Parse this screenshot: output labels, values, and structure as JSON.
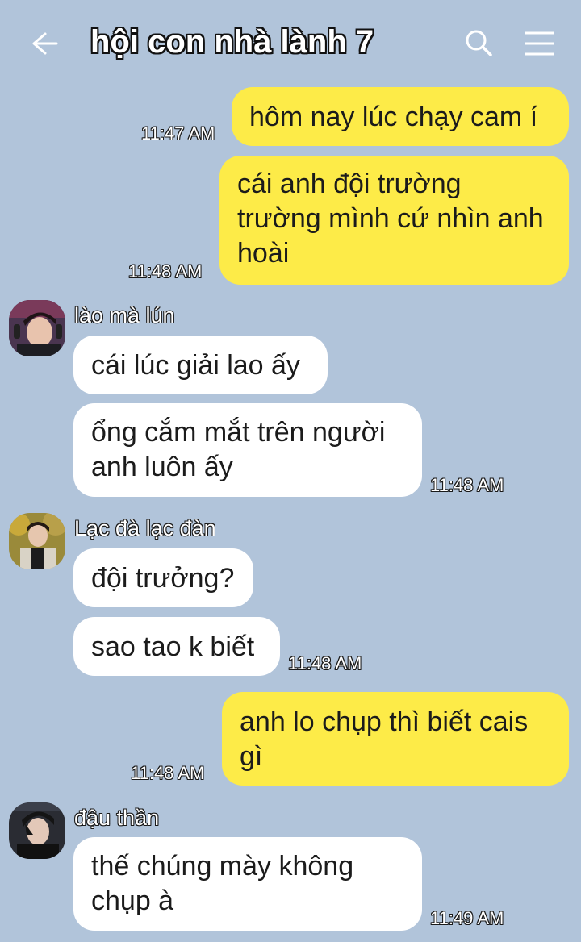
{
  "header": {
    "title": "hội con nhà lành 7",
    "back_icon": "arrow-left-icon",
    "search_icon": "search-icon",
    "menu_icon": "hamburger-menu-icon"
  },
  "colors": {
    "background": "#b1c4da",
    "outgoing_bubble": "#fdeb48",
    "incoming_bubble": "#ffffff"
  },
  "messages": [
    {
      "direction": "out",
      "text": "hôm nay lúc chạy cam í",
      "time": "11:47 AM"
    },
    {
      "direction": "out",
      "text_lines": [
        "cái anh đội trường",
        "trường mình cứ nhìn anh",
        "hoài"
      ],
      "time": "11:48 AM"
    },
    {
      "direction": "in",
      "sender": "lào mà lún",
      "text": "cái lúc giải lao ấy"
    },
    {
      "direction": "in",
      "text_lines": [
        "ổng cắm mắt trên người",
        "anh luôn ấy"
      ],
      "time": "11:48 AM"
    },
    {
      "direction": "in",
      "sender": "Lạc đà lạc đàn",
      "text": "đội trưởng?"
    },
    {
      "direction": "in",
      "text": "sao tao k biết",
      "time": "11:48 AM"
    },
    {
      "direction": "out",
      "text_lines": [
        "anh lo chụp thì biết cais",
        "gì"
      ],
      "time": "11:48 AM"
    },
    {
      "direction": "in",
      "sender": "đậu thần",
      "text_lines": [
        "thế chúng mày không",
        "chụp à"
      ],
      "time": "11:49 AM"
    }
  ]
}
